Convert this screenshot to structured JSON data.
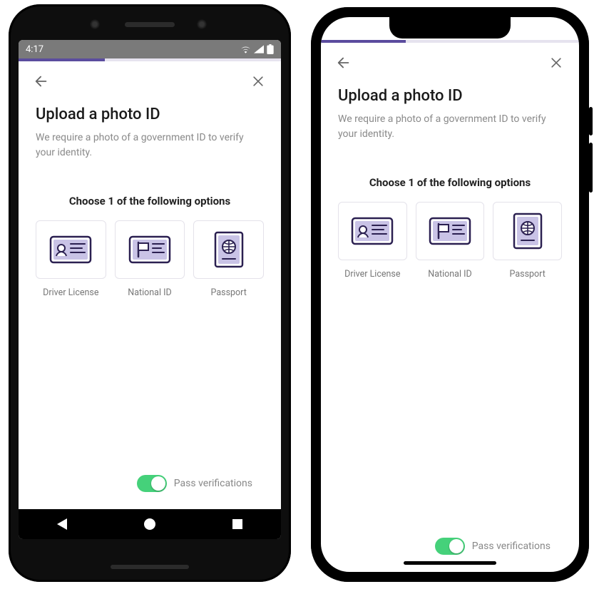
{
  "brand": {
    "accent": "#5b4c9e",
    "toggle_on": "#45d17a"
  },
  "statusbar": {
    "time": "4:17"
  },
  "progress": {
    "percent": 33
  },
  "topbar": {
    "back_icon": "arrow-left",
    "close_icon": "close"
  },
  "page": {
    "title": "Upload a photo ID",
    "subtitle": "We require a photo of a government ID to verify your identity.",
    "section_label": "Choose 1 of the following options"
  },
  "options": [
    {
      "id": "driver-license",
      "label": "Driver License",
      "icon": "id-card"
    },
    {
      "id": "national-id",
      "label": "National ID",
      "icon": "flag-card"
    },
    {
      "id": "passport",
      "label": "Passport",
      "icon": "passport"
    }
  ],
  "toggle": {
    "label": "Pass verifications",
    "on": true
  }
}
